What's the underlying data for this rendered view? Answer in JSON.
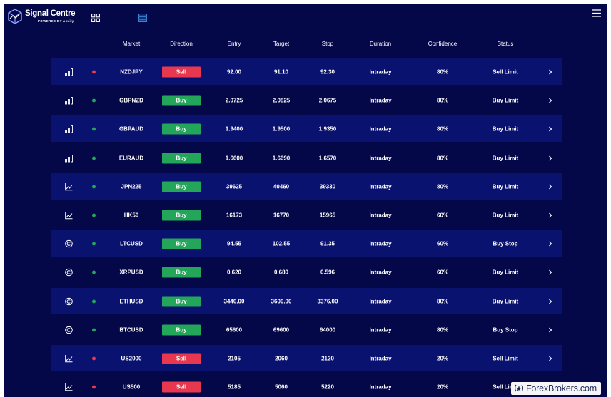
{
  "app": {
    "logo_title": "Signal Centre",
    "logo_subtitle": "POWERED BY Acuity"
  },
  "colors": {
    "background": "#050848",
    "row_alt": "#0a1270",
    "sell": "#e8384f",
    "buy": "#23a55a",
    "dot_sell": "#e8384f",
    "dot_buy": "#23a55a",
    "list_view_active": "#3b8fe3"
  },
  "columns": {
    "market": "Market",
    "direction": "Direction",
    "entry": "Entry",
    "target": "Target",
    "stop": "Stop",
    "duration": "Duration",
    "confidence": "Confidence",
    "status": "Status"
  },
  "signals": [
    {
      "icon": "bar-chart-icon",
      "market": "NZDJPY",
      "direction": "Sell",
      "entry": "92.00",
      "target": "91.10",
      "stop": "92.30",
      "duration": "Intraday",
      "confidence": "80%",
      "status": "Sell Limit"
    },
    {
      "icon": "bar-chart-icon",
      "market": "GBPNZD",
      "direction": "Buy",
      "entry": "2.0725",
      "target": "2.0825",
      "stop": "2.0675",
      "duration": "Intraday",
      "confidence": "80%",
      "status": "Buy Limit"
    },
    {
      "icon": "bar-chart-icon",
      "market": "GBPAUD",
      "direction": "Buy",
      "entry": "1.9400",
      "target": "1.9500",
      "stop": "1.9350",
      "duration": "Intraday",
      "confidence": "80%",
      "status": "Buy Limit"
    },
    {
      "icon": "bar-chart-icon",
      "market": "EURAUD",
      "direction": "Buy",
      "entry": "1.6600",
      "target": "1.6690",
      "stop": "1.6570",
      "duration": "Intraday",
      "confidence": "80%",
      "status": "Buy Limit"
    },
    {
      "icon": "line-chart-icon",
      "market": "JPN225",
      "direction": "Buy",
      "entry": "39625",
      "target": "40460",
      "stop": "39330",
      "duration": "Intraday",
      "confidence": "80%",
      "status": "Buy Limit"
    },
    {
      "icon": "line-chart-icon",
      "market": "HK50",
      "direction": "Buy",
      "entry": "16173",
      "target": "16770",
      "stop": "15965",
      "duration": "Intraday",
      "confidence": "60%",
      "status": "Buy Limit"
    },
    {
      "icon": "crypto-coin-icon",
      "market": "LTCUSD",
      "direction": "Buy",
      "entry": "94.55",
      "target": "102.55",
      "stop": "91.35",
      "duration": "Intraday",
      "confidence": "60%",
      "status": "Buy Stop"
    },
    {
      "icon": "crypto-coin-icon",
      "market": "XRPUSD",
      "direction": "Buy",
      "entry": "0.620",
      "target": "0.680",
      "stop": "0.596",
      "duration": "Intraday",
      "confidence": "60%",
      "status": "Buy Limit"
    },
    {
      "icon": "crypto-coin-icon",
      "market": "ETHUSD",
      "direction": "Buy",
      "entry": "3440.00",
      "target": "3600.00",
      "stop": "3376.00",
      "duration": "Intraday",
      "confidence": "80%",
      "status": "Buy Limit"
    },
    {
      "icon": "crypto-coin-icon",
      "market": "BTCUSD",
      "direction": "Buy",
      "entry": "65600",
      "target": "69600",
      "stop": "64000",
      "duration": "Intraday",
      "confidence": "80%",
      "status": "Buy Stop"
    },
    {
      "icon": "line-chart-icon",
      "market": "US2000",
      "direction": "Sell",
      "entry": "2105",
      "target": "2060",
      "stop": "2120",
      "duration": "Intraday",
      "confidence": "20%",
      "status": "Sell Limit"
    },
    {
      "icon": "line-chart-icon",
      "market": "US500",
      "direction": "Sell",
      "entry": "5185",
      "target": "5060",
      "stop": "5220",
      "duration": "Intraday",
      "confidence": "20%",
      "status": "Sell Limit"
    }
  ],
  "watermark": {
    "text": "ForexBrokers.com"
  }
}
